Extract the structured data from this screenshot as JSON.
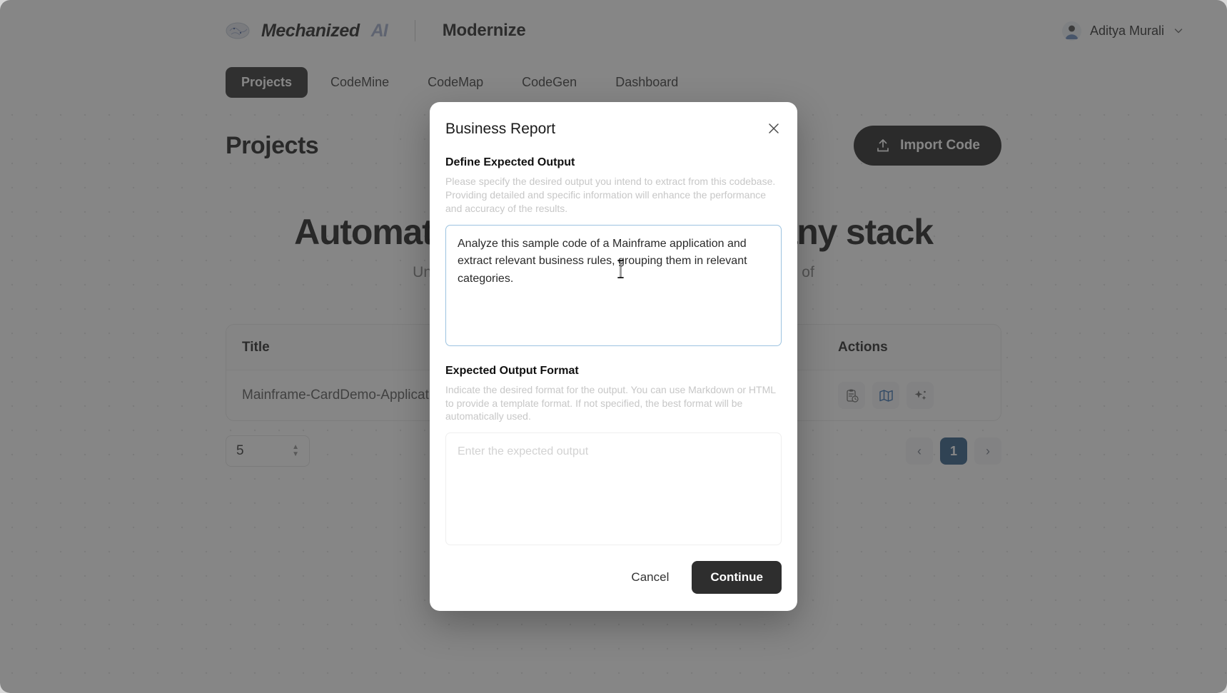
{
  "header": {
    "brand_name": "Mechanized",
    "brand_ai": "AI",
    "product": "Modernize",
    "user_name": "Aditya Murali",
    "chevron_icon": "chevron-down-icon",
    "avatar_icon": "avatar"
  },
  "nav": {
    "items": [
      {
        "label": "Projects",
        "active": true
      },
      {
        "label": "CodeMine",
        "active": false
      },
      {
        "label": "CodeMap",
        "active": false
      },
      {
        "label": "CodeGen",
        "active": false
      },
      {
        "label": "Dashboard",
        "active": false
      }
    ]
  },
  "page": {
    "title": "Projects",
    "import_label": "Import Code",
    "hero_title": "Automated modernization for any stack",
    "hero_sub": "Understand, document and transform legacy code instead of"
  },
  "table": {
    "columns": [
      "Title",
      "Actions"
    ],
    "rows": [
      {
        "title": "Mainframe-CardDemo-Application"
      }
    ],
    "action_icons": [
      "report-icon",
      "codemap-icon",
      "sparkles-icon"
    ],
    "page_size": "5",
    "pagination": {
      "prev": "‹",
      "next": "›",
      "pages": [
        "1"
      ],
      "current": "1"
    }
  },
  "modal": {
    "title": "Business Report",
    "close_icon": "close-icon",
    "section1": {
      "label": "Define Expected Output",
      "description": "Please specify the desired output you intend to extract from this codebase. Providing detailed and specific information will enhance the performance and accuracy of the results.",
      "value": "Analyze this sample code of a Mainframe application and extract relevant business rules, grouping them in relevant categories.",
      "placeholder": "Enter the expected output"
    },
    "section2": {
      "label": "Expected Output Format",
      "description": "Indicate the desired format for the output. You can use Markdown or HTML to provide a template format. If not specified, the best format will be automatically used.",
      "value": "",
      "placeholder": "Enter the expected output"
    },
    "cancel_label": "Cancel",
    "continue_label": "Continue"
  },
  "colors": {
    "accent_dark": "#1d1d1d",
    "pagination_active": "#1f4f7d",
    "focus_border": "#9cc3e0",
    "overlay": "rgba(60,60,60,0.62)"
  }
}
